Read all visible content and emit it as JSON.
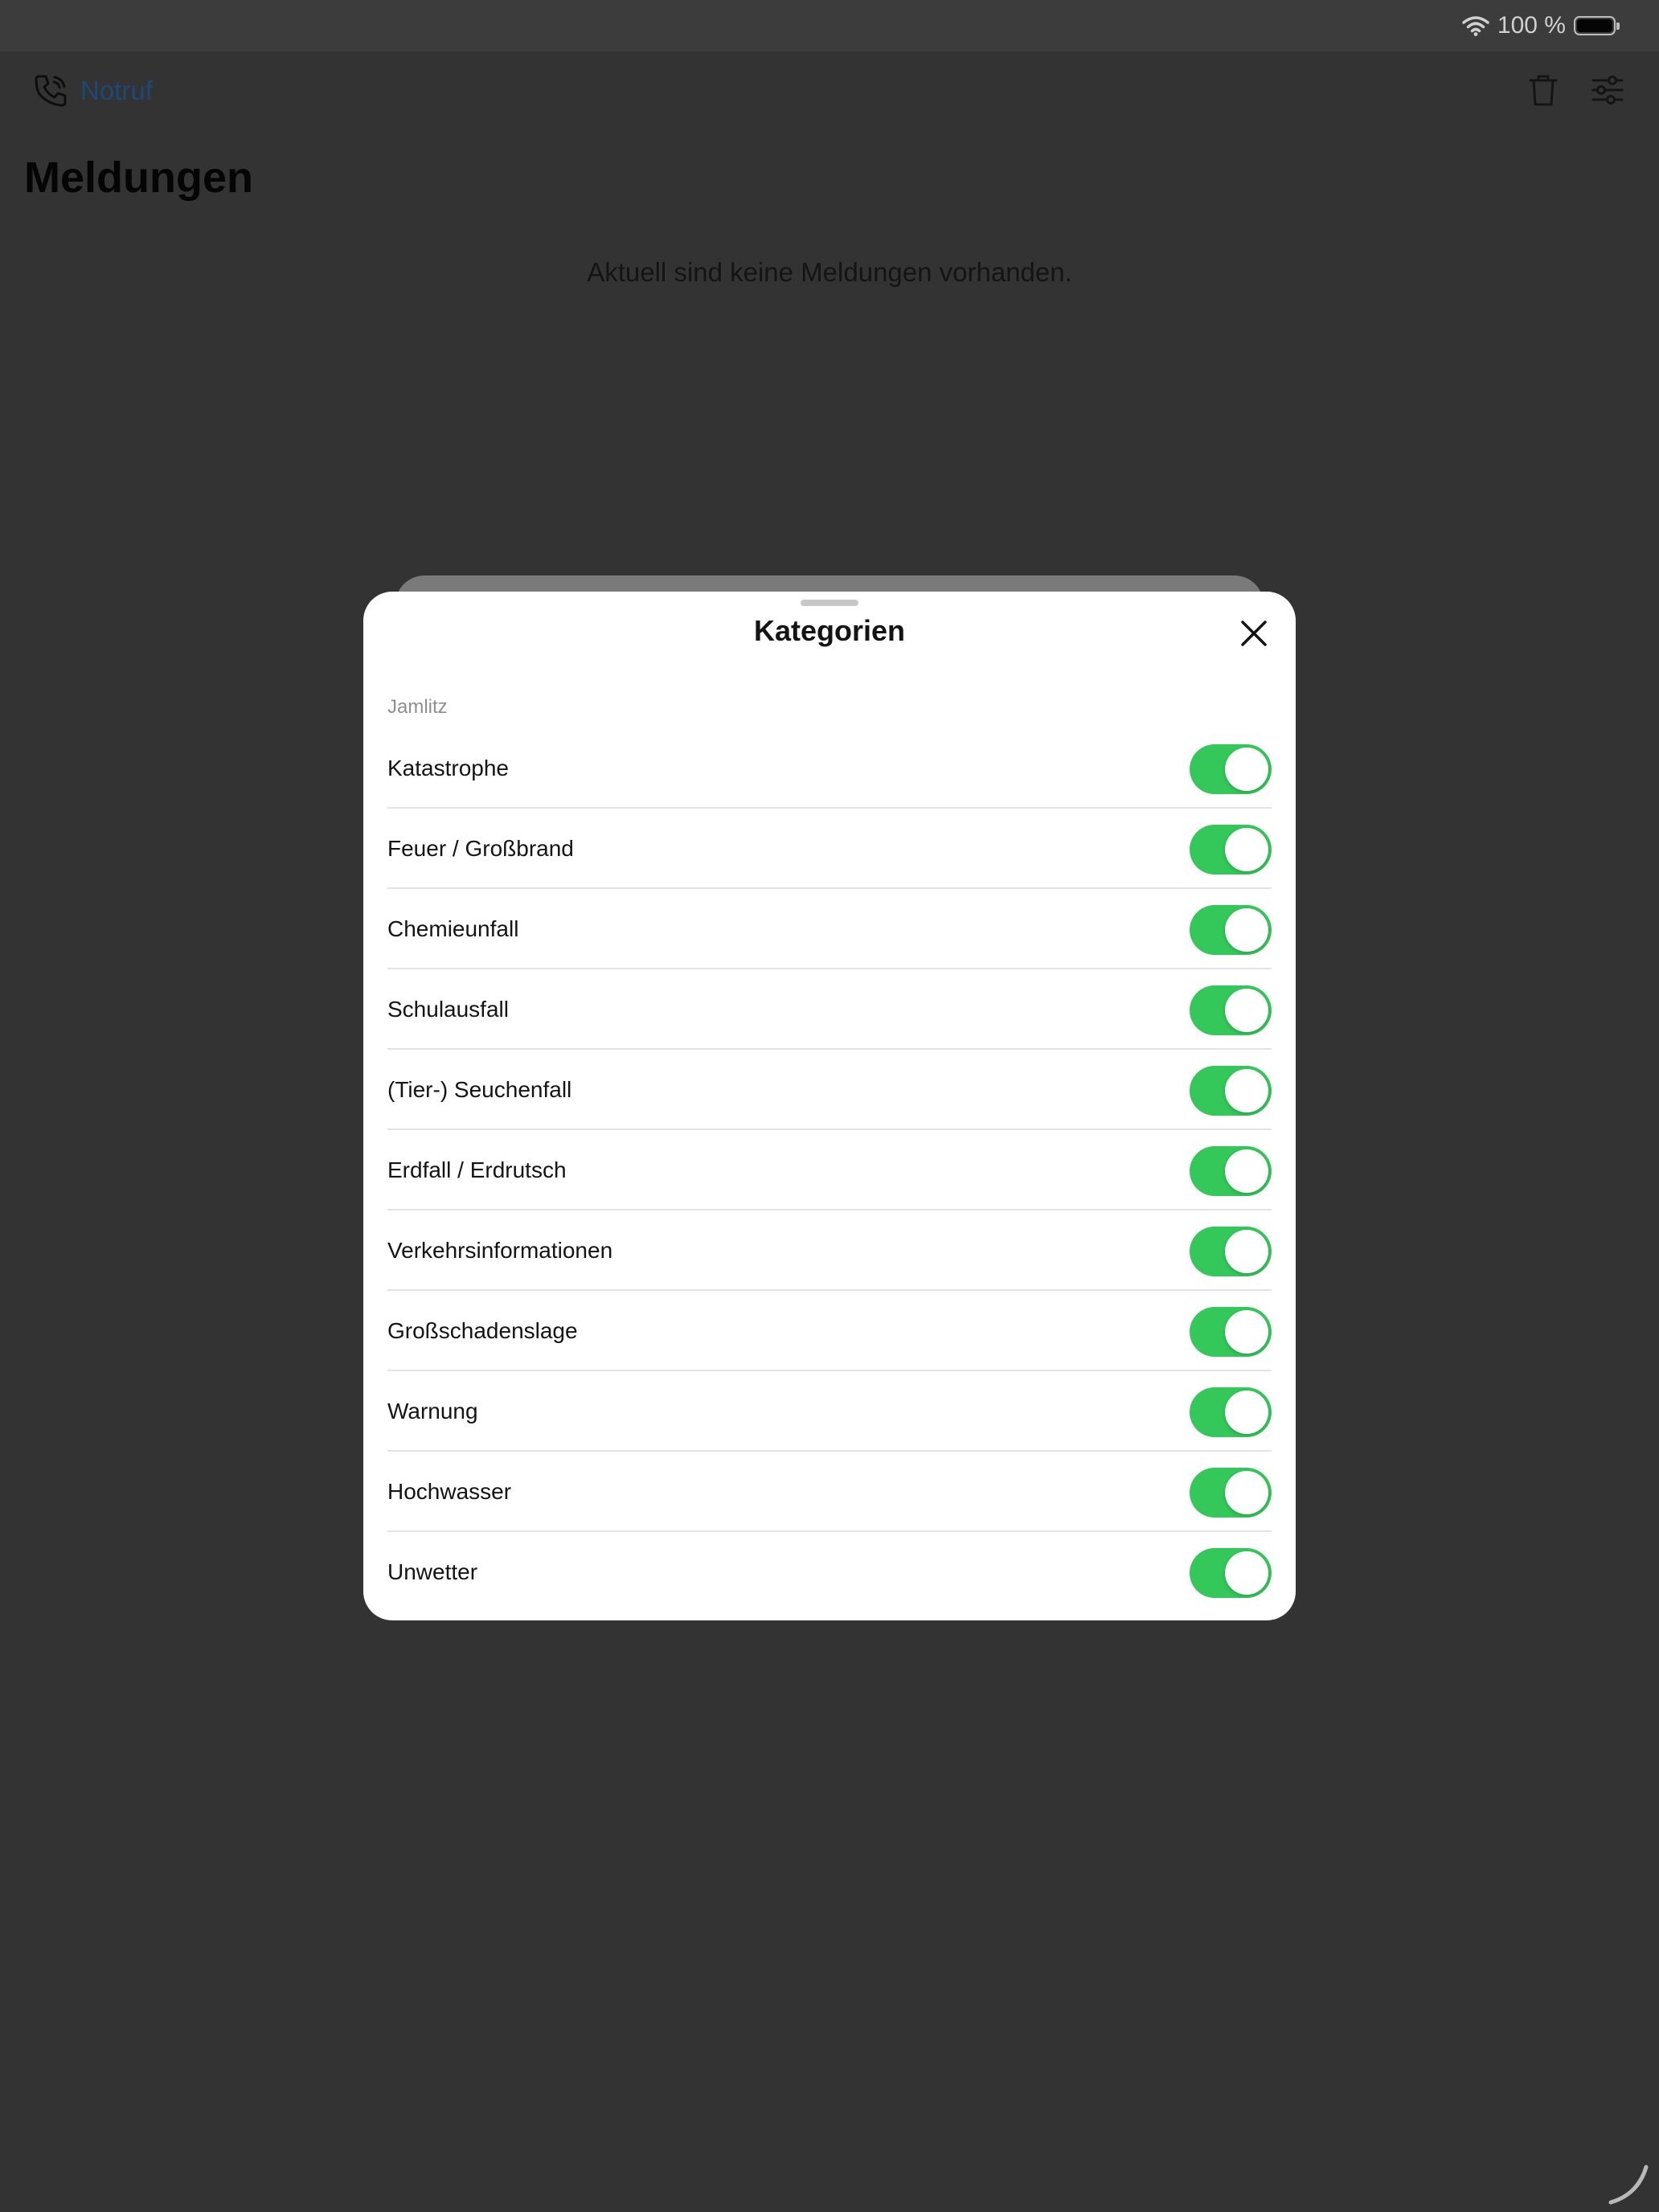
{
  "status_bar": {
    "battery_text": "100 %",
    "icons": [
      "wifi-icon",
      "battery-icon"
    ]
  },
  "nav": {
    "emergency_label": "Notruf",
    "icons": [
      "emergency-phone-icon",
      "trash-icon",
      "filter-sliders-icon"
    ],
    "link_color": "#1c4a74"
  },
  "page": {
    "title": "Meldungen",
    "empty_message": "Aktuell sind keine Meldungen vorhanden."
  },
  "sheet": {
    "title": "Kategorien",
    "close_icon": "close-icon",
    "section_header": "Jamlitz",
    "toggle_color": "#34c759",
    "items": [
      {
        "label": "Katastrophe",
        "enabled": true
      },
      {
        "label": "Feuer / Großbrand",
        "enabled": true
      },
      {
        "label": "Chemieunfall",
        "enabled": true
      },
      {
        "label": "Schulausfall",
        "enabled": true
      },
      {
        "label": "(Tier-) Seuchenfall",
        "enabled": true
      },
      {
        "label": "Erdfall / Erdrutsch",
        "enabled": true
      },
      {
        "label": "Verkehrsinformationen",
        "enabled": true
      },
      {
        "label": "Großschadenslage",
        "enabled": true
      },
      {
        "label": "Warnung",
        "enabled": true
      },
      {
        "label": "Hochwasser",
        "enabled": true
      },
      {
        "label": "Unwetter",
        "enabled": true
      }
    ]
  }
}
